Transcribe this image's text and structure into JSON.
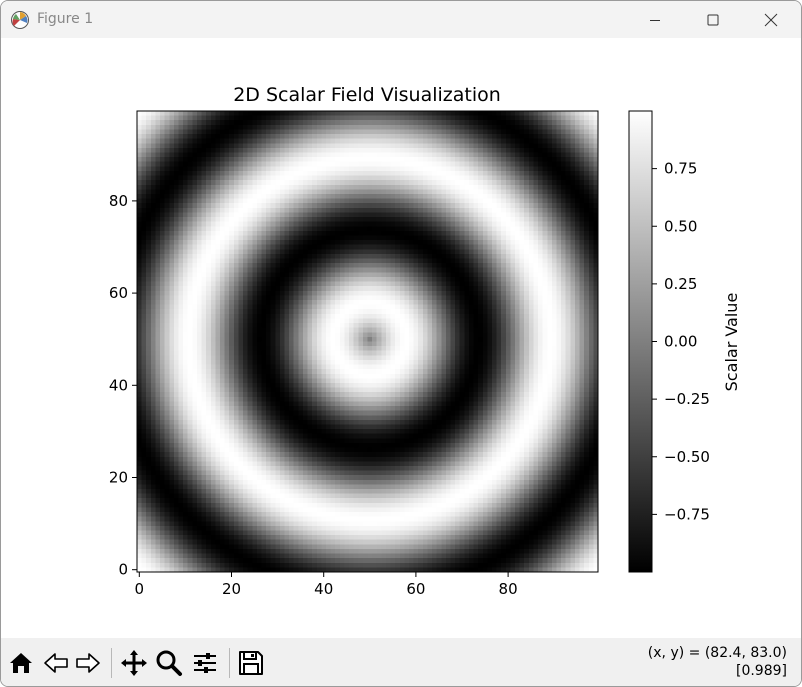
{
  "window": {
    "title": "Figure 1"
  },
  "toolbar": {
    "buttons": [
      "home-icon",
      "back-arrow-icon",
      "forward-arrow-icon",
      "pan-move-icon",
      "zoom-magnifier-icon",
      "configure-subplots-icon",
      "save-disk-icon"
    ],
    "coords_line1": "(x, y) = (82.4, 83.0)",
    "coords_line2": "[0.989]"
  },
  "chart_data": {
    "type": "heatmap",
    "title": "2D Scalar Field Visualization",
    "colormap": "gray",
    "field": "concentric rings, value = sin(r / 5) with r = distance from center (50, 50)",
    "x_ticks": [
      "0",
      "20",
      "40",
      "60",
      "80"
    ],
    "y_ticks": [
      "0",
      "20",
      "40",
      "60",
      "80"
    ],
    "xlim": [
      0,
      99
    ],
    "ylim": [
      0,
      99
    ],
    "grid_size": 100,
    "colorbar": {
      "label": "Scalar Value",
      "ticks": [
        "0.75",
        "0.50",
        "0.25",
        "0.00",
        "−0.25",
        "−0.50",
        "−0.75"
      ],
      "tick_values": [
        0.75,
        0.5,
        0.25,
        0.0,
        -0.25,
        -0.5,
        -0.75
      ],
      "range": [
        -1,
        1
      ]
    }
  }
}
